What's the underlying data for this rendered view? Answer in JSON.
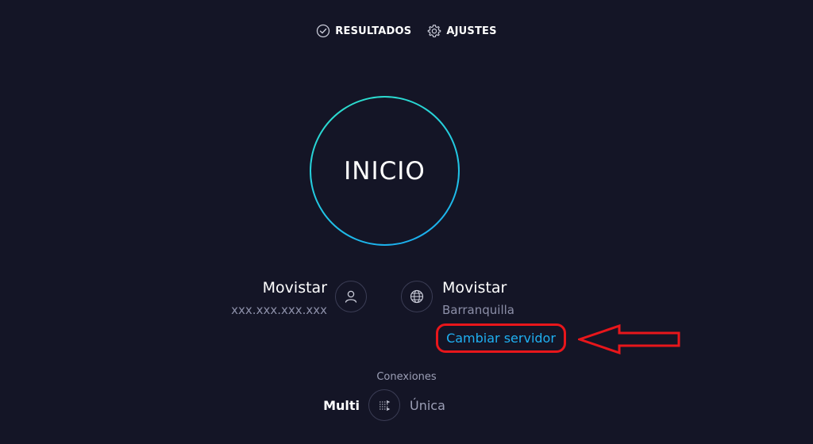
{
  "nav": {
    "results": "RESULTADOS",
    "settings": "AJUSTES"
  },
  "go_button": {
    "label": "INICIO"
  },
  "provider": {
    "name": "Movistar",
    "ip": "xxx.xxx.xxx.xxx"
  },
  "server": {
    "name": "Movistar",
    "location": "Barranquilla",
    "change_label": "Cambiar servidor"
  },
  "connections": {
    "label": "Conexiones",
    "options": [
      "Multi",
      "Única"
    ],
    "selected": "Multi"
  },
  "colors": {
    "background": "#141526",
    "ring_start": "#2ee0c8",
    "ring_end": "#1aa8f0",
    "link": "#1fb0f2",
    "annotation": "#e8161b",
    "muted": "#8c8fa8"
  },
  "icons": [
    "check-circle-icon",
    "gear-icon",
    "user-icon",
    "globe-icon",
    "connections-icon",
    "arrow-left-icon"
  ]
}
